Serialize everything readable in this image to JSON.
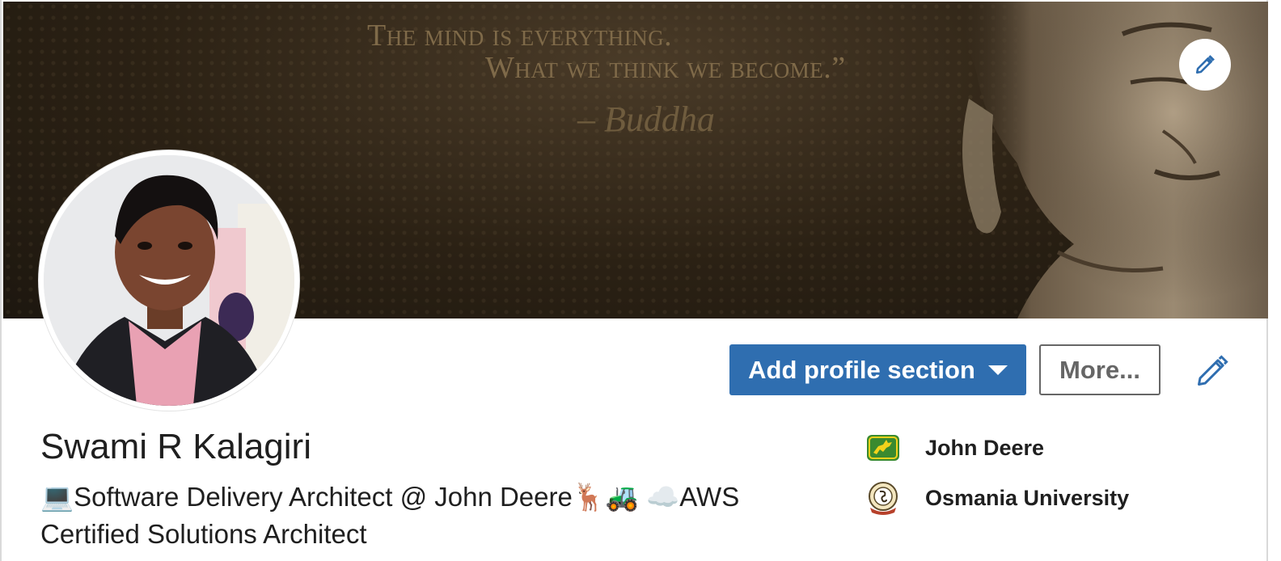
{
  "banner": {
    "quote_line1": "The mind is everything.",
    "quote_line2": "What we think we become.”",
    "quote_author": "– Buddha",
    "edit_icon": "pencil-icon"
  },
  "profile": {
    "name": "Swami R Kalagiri",
    "headline_line1": "💻Software Delivery Architect @ John Deere🦌🚜 ☁️AWS",
    "headline_line2": "Certified Solutions Architect"
  },
  "actions": {
    "add_section_label": "Add profile section",
    "more_label": "More...",
    "edit_intro_icon": "pencil-icon"
  },
  "organizations": {
    "company": "John Deere",
    "school": "Osmania University"
  },
  "colors": {
    "primary": "#2f6eb0",
    "secondary_border": "#666666",
    "banner_dark": "#2b2114",
    "quote": "#7f6a49"
  }
}
